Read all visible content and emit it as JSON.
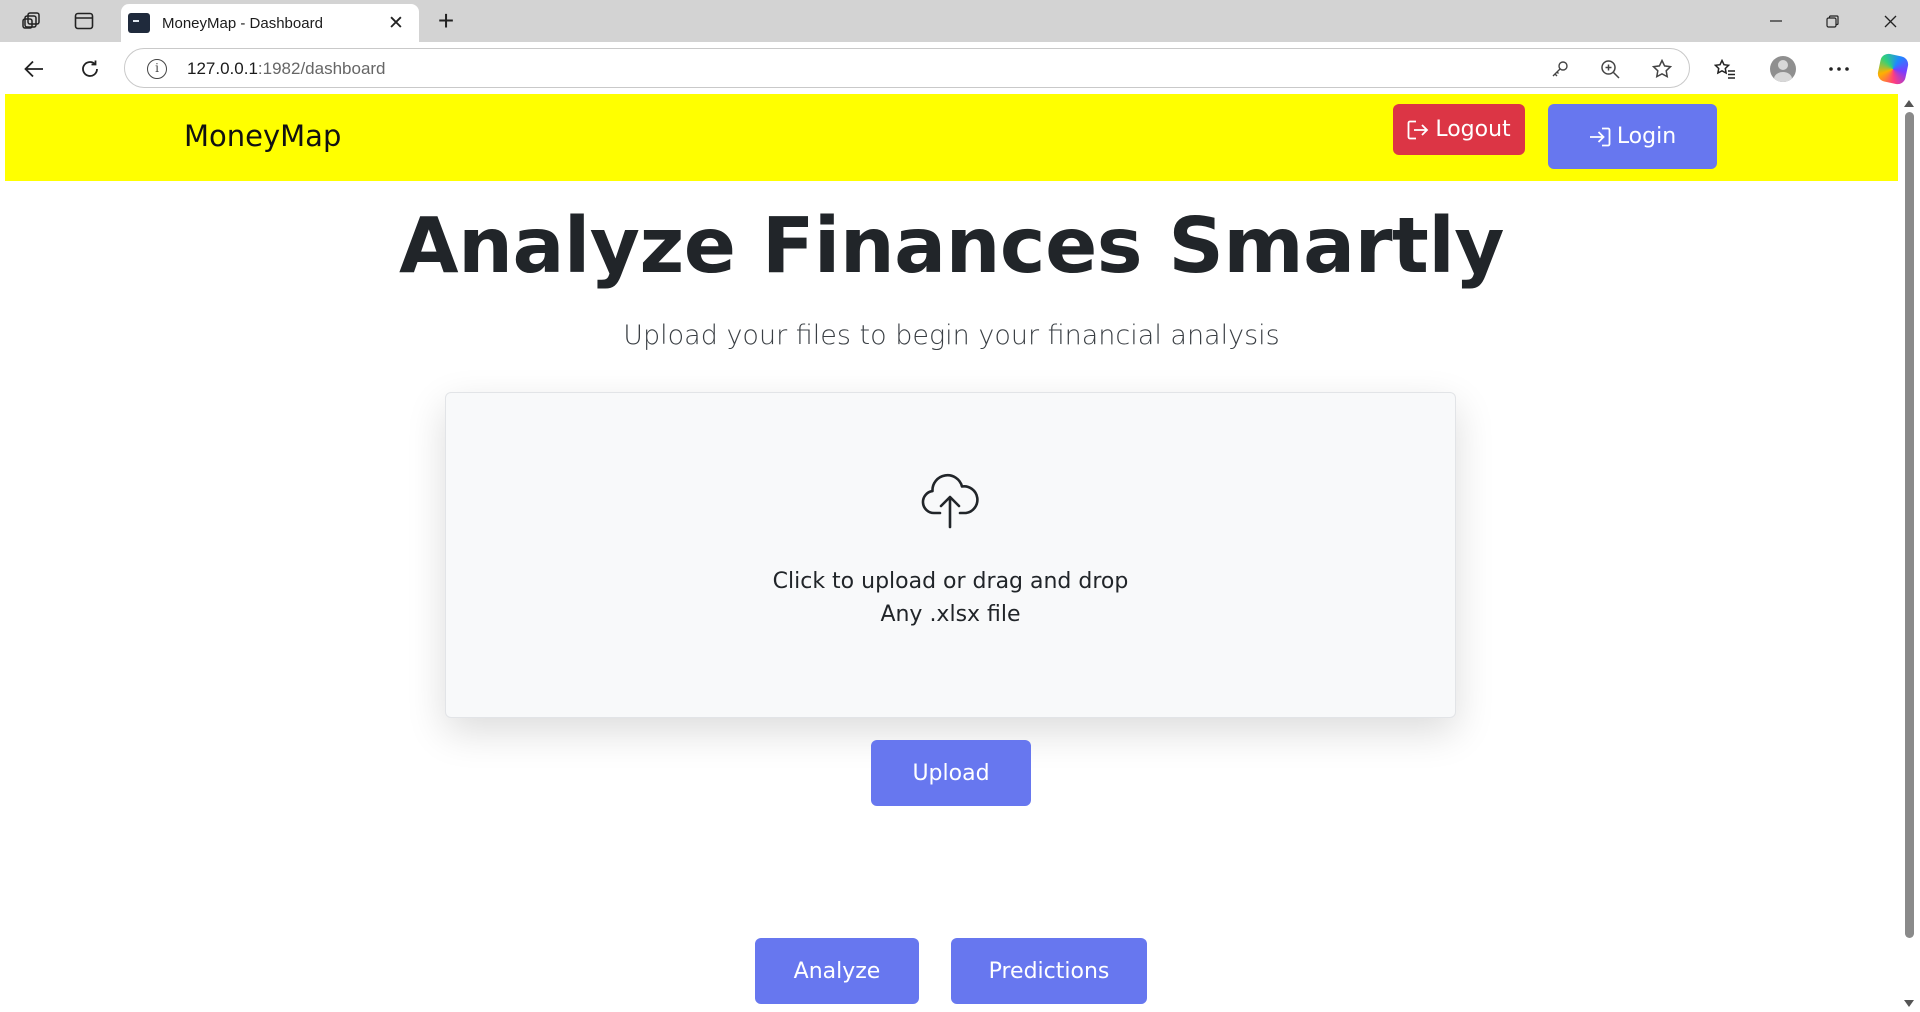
{
  "browser": {
    "tab_title": "MoneyMap - Dashboard",
    "url_host": "127.0.0.1",
    "url_rest": ":1982/dashboard",
    "new_tab": "+",
    "tab_close": "✕"
  },
  "navbar": {
    "brand": "MoneyMap",
    "logout_label": "Logout",
    "login_label": "Login"
  },
  "hero": {
    "title": "Analyze Finances Smartly",
    "subtitle": "Upload your files to begin your financial analysis"
  },
  "upload": {
    "instruction": "Click to upload or drag and drop",
    "file_hint": "Any .xlsx file",
    "button_label": "Upload"
  },
  "actions": {
    "analyze_label": "Analyze",
    "predictions_label": "Predictions"
  },
  "colors": {
    "navbar_bg": "#ffff00",
    "primary": "#6777ef",
    "danger": "#dc3545"
  },
  "icons": [
    "workspaces-icon",
    "vertical-tabs-icon",
    "back-icon",
    "refresh-icon",
    "info-icon",
    "key-icon",
    "zoom-icon",
    "favorite-star-icon",
    "favorites-icon",
    "profile-icon",
    "more-icon",
    "copilot-icon",
    "logout-icon",
    "login-icon",
    "cloud-upload-icon"
  ]
}
